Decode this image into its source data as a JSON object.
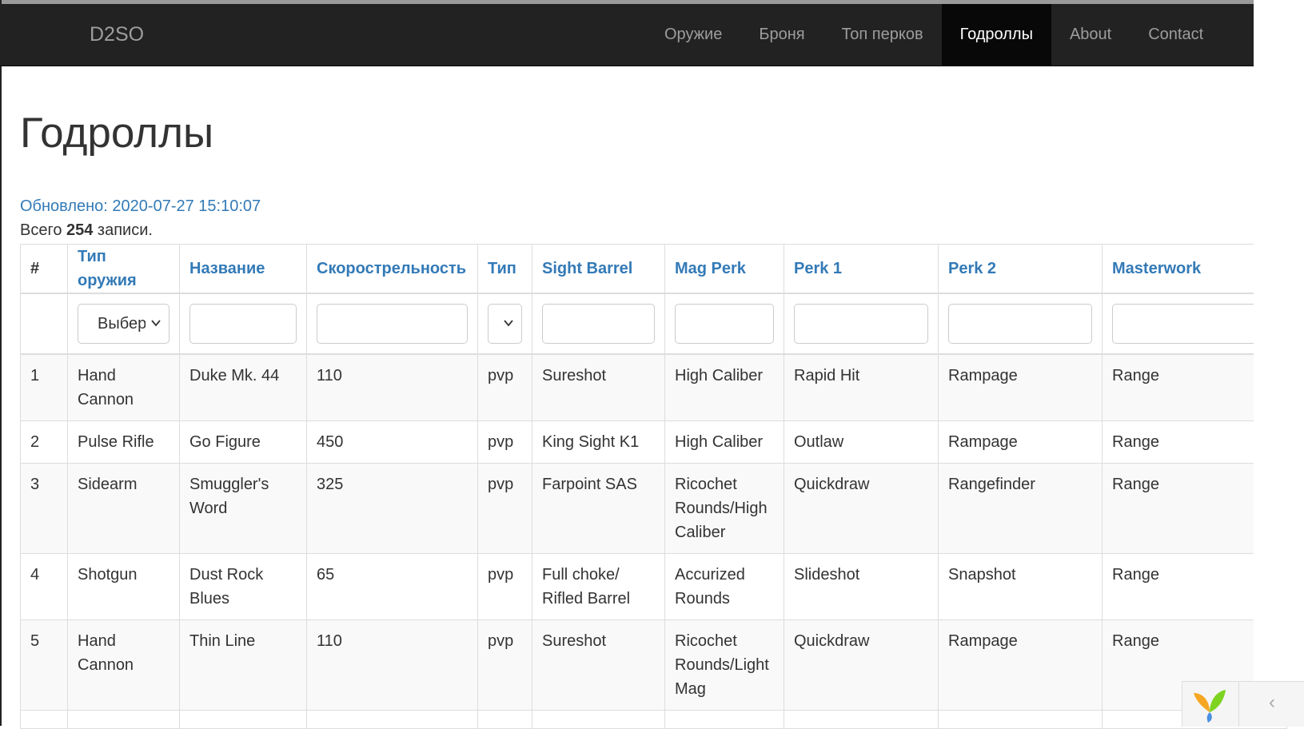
{
  "navbar": {
    "brand": "D2SO",
    "items": [
      {
        "label": "Оружие",
        "active": false
      },
      {
        "label": "Броня",
        "active": false
      },
      {
        "label": "Топ перков",
        "active": false
      },
      {
        "label": "Годроллы",
        "active": true
      },
      {
        "label": "About",
        "active": false
      },
      {
        "label": "Contact",
        "active": false
      }
    ]
  },
  "page": {
    "title": "Годроллы",
    "updated": "Обновлено: 2020-07-27 15:10:07",
    "summary_prefix": "Всего ",
    "summary_count": "254",
    "summary_suffix": " записи."
  },
  "table": {
    "columns": [
      "#",
      "Тип оружия",
      "Название",
      "Скорострельность",
      "Тип",
      "Sight Barrel",
      "Mag Perk",
      "Perk 1",
      "Perk 2",
      "Masterwork"
    ],
    "filters": {
      "weapon_type_selected": "Выберите",
      "type_selected": ""
    },
    "rows": [
      [
        "1",
        "Hand Cannon",
        "Duke Mk. 44",
        "110",
        "pvp",
        "Sureshot",
        "High Caliber",
        "Rapid Hit",
        "Rampage",
        "Range"
      ],
      [
        "2",
        "Pulse Rifle",
        "Go Figure",
        "450",
        "pvp",
        "King Sight K1",
        "High Caliber",
        "Outlaw",
        "Rampage",
        "Range"
      ],
      [
        "3",
        "Sidearm",
        "Smuggler's Word",
        "325",
        "pvp",
        "Farpoint SAS",
        "Ricochet Rounds/High Caliber",
        "Quickdraw",
        "Rangefinder",
        "Range"
      ],
      [
        "4",
        "Shotgun",
        "Dust Rock Blues",
        "65",
        "pvp",
        "Full choke/ Rifled Barrel",
        "Accurized Rounds",
        "Slideshot",
        "Snapshot",
        "Range"
      ],
      [
        "5",
        "Hand Cannon",
        "Thin Line",
        "110",
        "pvp",
        "Sureshot",
        "Ricochet Rounds/Light Mag",
        "Quickdraw",
        "Rampage",
        "Range"
      ],
      [
        "",
        "",
        "",
        "",
        "",
        "",
        "",
        "",
        "",
        ""
      ]
    ]
  },
  "colors": {
    "navbar_bg": "#222222",
    "active_nav_bg": "#080808",
    "link": "#337ab7",
    "stripe": "#f9f9f9"
  },
  "icons": {
    "select_arrow": "chevron-down-icon",
    "debug_logo": "yii-logo-icon",
    "debug_toggle": "chevron-left-icon"
  }
}
